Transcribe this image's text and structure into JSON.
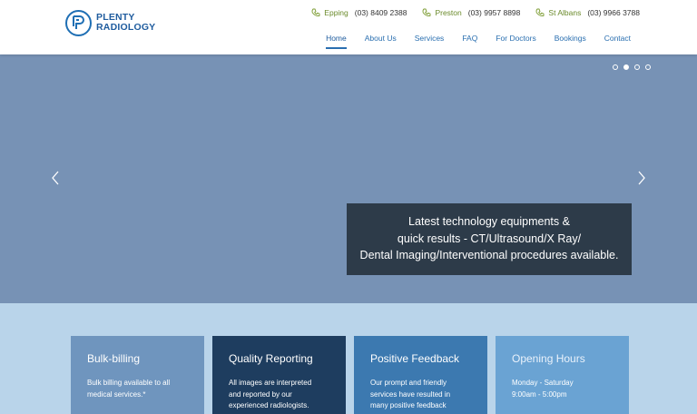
{
  "logo": {
    "line1": "PLENTY",
    "line2": "RADIOLOGY"
  },
  "phones": [
    {
      "location": "Epping",
      "number": "(03) 8409 2388"
    },
    {
      "location": "Preston",
      "number": "(03) 9957 8898"
    },
    {
      "location": "St Albans",
      "number": "(03) 9966 3788"
    }
  ],
  "nav": [
    "Home",
    "About Us",
    "Services",
    "FAQ",
    "For Doctors",
    "Bookings",
    "Contact"
  ],
  "hero": {
    "caption_lines": [
      "Latest technology equipments &",
      "quick results - CT/Ultrasound/X Ray/",
      "Dental Imaging/Interventional procedures available."
    ],
    "active_slide": 2,
    "slide_count": 4
  },
  "cards": [
    {
      "title": "Bulk-billing",
      "body_lines": [
        "Bulk billing available to all",
        "medical services.*"
      ]
    },
    {
      "title": "Quality Reporting",
      "body_lines": [
        "All images are interpreted",
        "and reported by our",
        "experienced radiologists."
      ]
    },
    {
      "title": "Positive Feedback",
      "body_lines": [
        "Our prompt and friendly",
        "services have resulted in",
        "many positive feedback"
      ]
    },
    {
      "title": "Opening Hours",
      "body_lines": [
        "Monday - Saturday",
        "9:00am - 5:00pm"
      ]
    }
  ],
  "colors": {
    "brand": "#1f6fb4",
    "accent_green": "#6a8a2a",
    "hero_bg": "#7792b5",
    "caption_bg": "#2d3b49"
  }
}
